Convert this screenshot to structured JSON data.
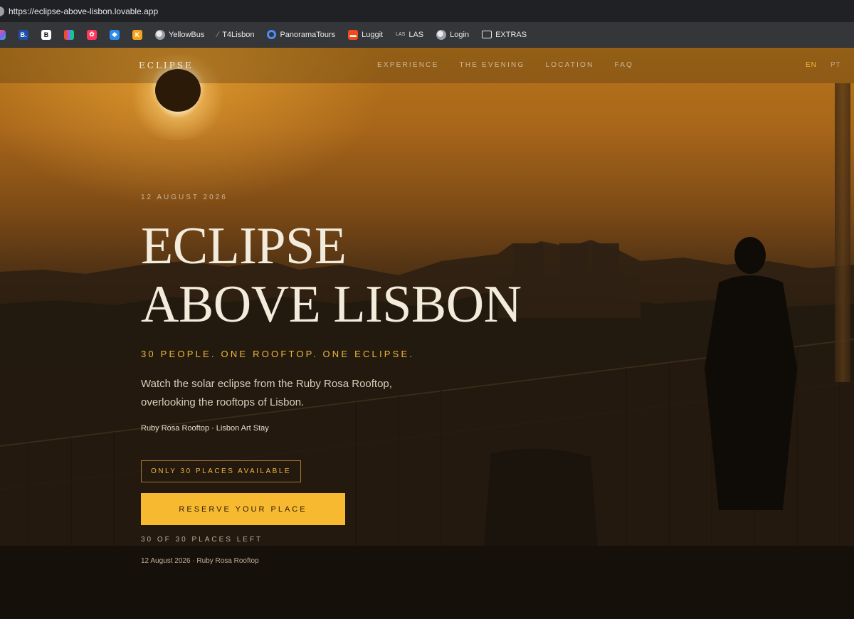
{
  "browser": {
    "url": "https://eclipse-above-lisbon.lovable.app",
    "bookmarks": [
      {
        "label": "",
        "icon": "multicolor-app-icon",
        "color": "#7b5cff"
      },
      {
        "label": "",
        "icon": "booking-icon",
        "color": "#1e4fa8",
        "glyph": "B."
      },
      {
        "label": "",
        "icon": "document-icon",
        "color": "#111111",
        "glyph": "B"
      },
      {
        "label": "",
        "icon": "figma-icon",
        "color": "#f24e1e"
      },
      {
        "label": "",
        "icon": "airbnb-icon",
        "color": "#ff385c"
      },
      {
        "label": "",
        "icon": "cube-icon",
        "color": "#2a8cf0"
      },
      {
        "label": "",
        "icon": "k-icon",
        "color": "#f3a51c",
        "glyph": "K"
      },
      {
        "label": "YellowBus",
        "icon": "globe-icon"
      },
      {
        "label": "T4Lisbon",
        "icon": "slash-icon"
      },
      {
        "label": "PanoramaTours",
        "icon": "circle-icon"
      },
      {
        "label": "Luggit",
        "icon": "luggit-icon",
        "color": "#f04a1d"
      },
      {
        "label": "LAS",
        "icon": "las-icon",
        "glyph": "LAS"
      },
      {
        "label": "Login",
        "icon": "globe-icon"
      },
      {
        "label": "EXTRAS",
        "icon": "folder-icon"
      }
    ]
  },
  "nav": {
    "brand": "ECLIPSE",
    "links": [
      "EXPERIENCE",
      "THE EVENING",
      "LOCATION",
      "FAQ"
    ],
    "lang_en": "EN",
    "lang_pt": "PT"
  },
  "hero": {
    "date": "12 AUGUST 2026",
    "title_line1": "ECLIPSE",
    "title_line2": "ABOVE LISBON",
    "tagline": "30 PEOPLE. ONE ROOFTOP. ONE ECLIPSE.",
    "desc_line1": "Watch the solar eclipse from the Ruby Rosa Rooftop,",
    "desc_line2": "overlooking the rooftops of Lisbon.",
    "venue": "Ruby Rosa Rooftop · Lisbon Art Stay",
    "badge": "ONLY 30 PLACES AVAILABLE",
    "cta": "RESERVE YOUR PLACE",
    "places_left": "30 OF 30 PLACES LEFT",
    "footnote": "12 August 2026 · Ruby Rosa Rooftop"
  },
  "colors": {
    "accent": "#f7b92f",
    "text": "#f3ecdd"
  }
}
